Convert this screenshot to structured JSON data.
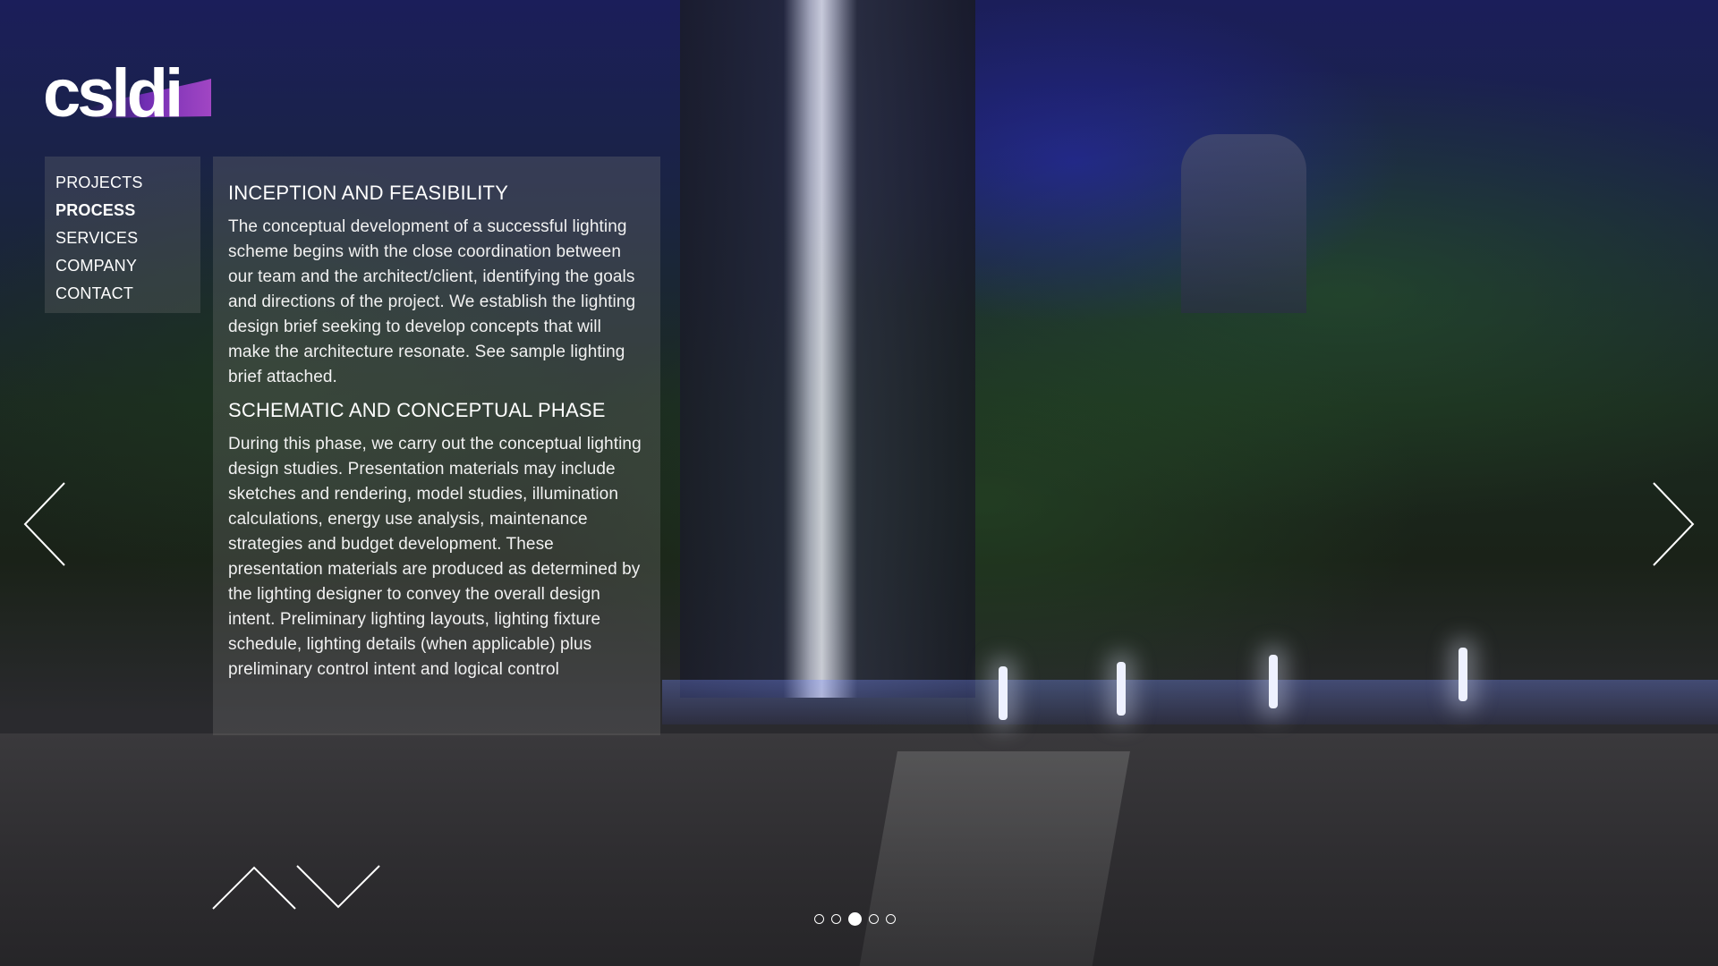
{
  "brand": {
    "logo_text": "csldi"
  },
  "nav": {
    "items": [
      {
        "label": "PROJECTS",
        "active": false
      },
      {
        "label": "PROCESS",
        "active": true
      },
      {
        "label": "SERVICES",
        "active": false
      },
      {
        "label": "COMPANY",
        "active": false
      },
      {
        "label": "CONTACT",
        "active": false
      }
    ]
  },
  "content": {
    "sections": [
      {
        "heading": "INCEPTION AND FEASIBILITY",
        "body": "The conceptual development of a successful lighting scheme begins with the close coordination between our team and the architect/client, identifying the goals and directions of the project. We establish the lighting design brief seeking to develop concepts that will make the architecture resonate. See sample lighting brief attached."
      },
      {
        "heading": "SCHEMATIC AND CONCEPTUAL PHASE",
        "body": "During this phase, we carry out the conceptual lighting design studies. Presentation materials may include sketches and rendering, model studies, illumination calculations, energy use analysis, maintenance strategies and budget development. These presentation materials are produced as determined by the lighting designer to convey the overall design intent. Preliminary lighting layouts, lighting fixture schedule, lighting details (when applicable) plus preliminary control intent and logical control"
      }
    ]
  },
  "controls": {
    "prev_icon": "chevron-left-icon",
    "next_icon": "chevron-right-icon",
    "scroll_up_icon": "chevron-up-icon",
    "scroll_down_icon": "chevron-down-icon"
  },
  "pagination": {
    "total": 5,
    "current": 3
  },
  "colors": {
    "logo_accent": "#7b2fbf",
    "panel_overlay": "rgba(120,120,120,0.30)",
    "text": "#ffffff"
  }
}
